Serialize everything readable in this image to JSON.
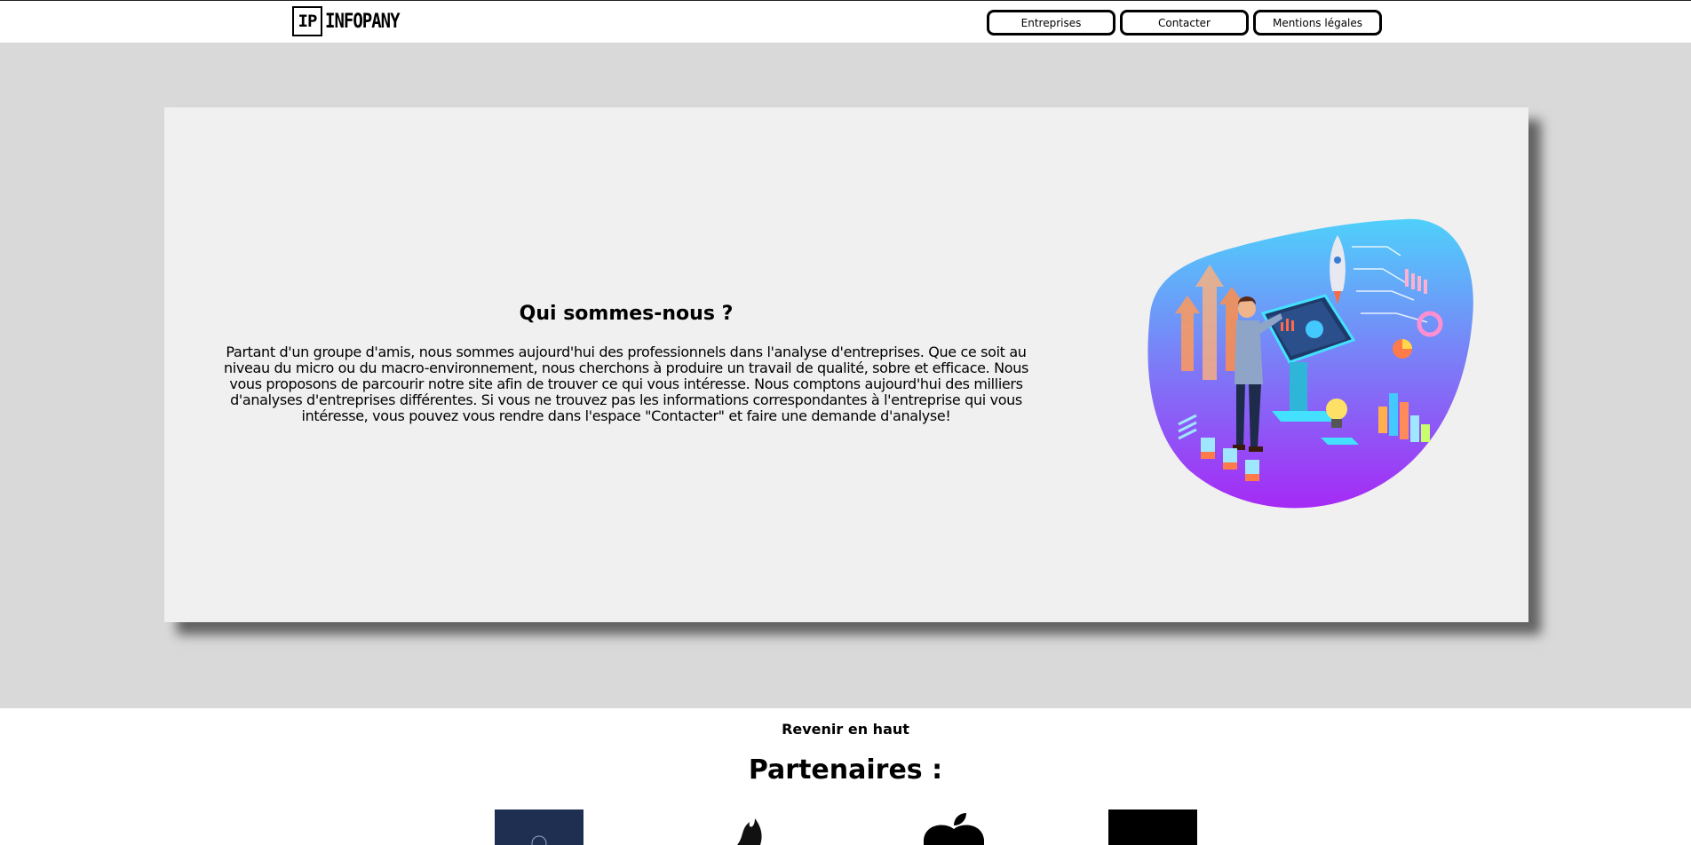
{
  "brand": {
    "logo_mark": "IP",
    "name": "INFOPANY"
  },
  "nav": {
    "items": [
      {
        "label": "Entreprises"
      },
      {
        "label": "Contacter"
      },
      {
        "label": "Mentions légales"
      }
    ]
  },
  "about": {
    "title": "Qui sommes-nous ?",
    "text": "Partant d'un groupe d'amis, nous sommes aujourd'hui des professionnels dans l'analyse d'entreprises. Que ce soit au niveau du micro ou du macro-environnement, nous cherchons à produire un travail de qualité, sobre et efficace. Nous vous proposons de parcourir notre site afin de trouver ce qui vous intéresse. Nous comptons aujourd'hui des milliers d'analyses d'entreprises différentes. Si vous ne trouvez pas les informations correspondantes à l'entreprise qui vous intéresse, vous pouvez vous rendre dans l'espace \"Contacter\" et faire une demande d'analyse!"
  },
  "footer": {
    "back_to_top": "Revenir en haut",
    "partners_title": "Partenaires :",
    "partners": [
      {
        "icon": "navy-seal-logo"
      },
      {
        "icon": "flame-logo"
      },
      {
        "icon": "apple-logo"
      },
      {
        "icon": "black-square-logo"
      }
    ]
  },
  "colors": {
    "page_band": "#d9d9d9",
    "card": "#f0f0f0",
    "blob_top": "#4fd0fb",
    "blob_bottom": "#a52af5"
  }
}
